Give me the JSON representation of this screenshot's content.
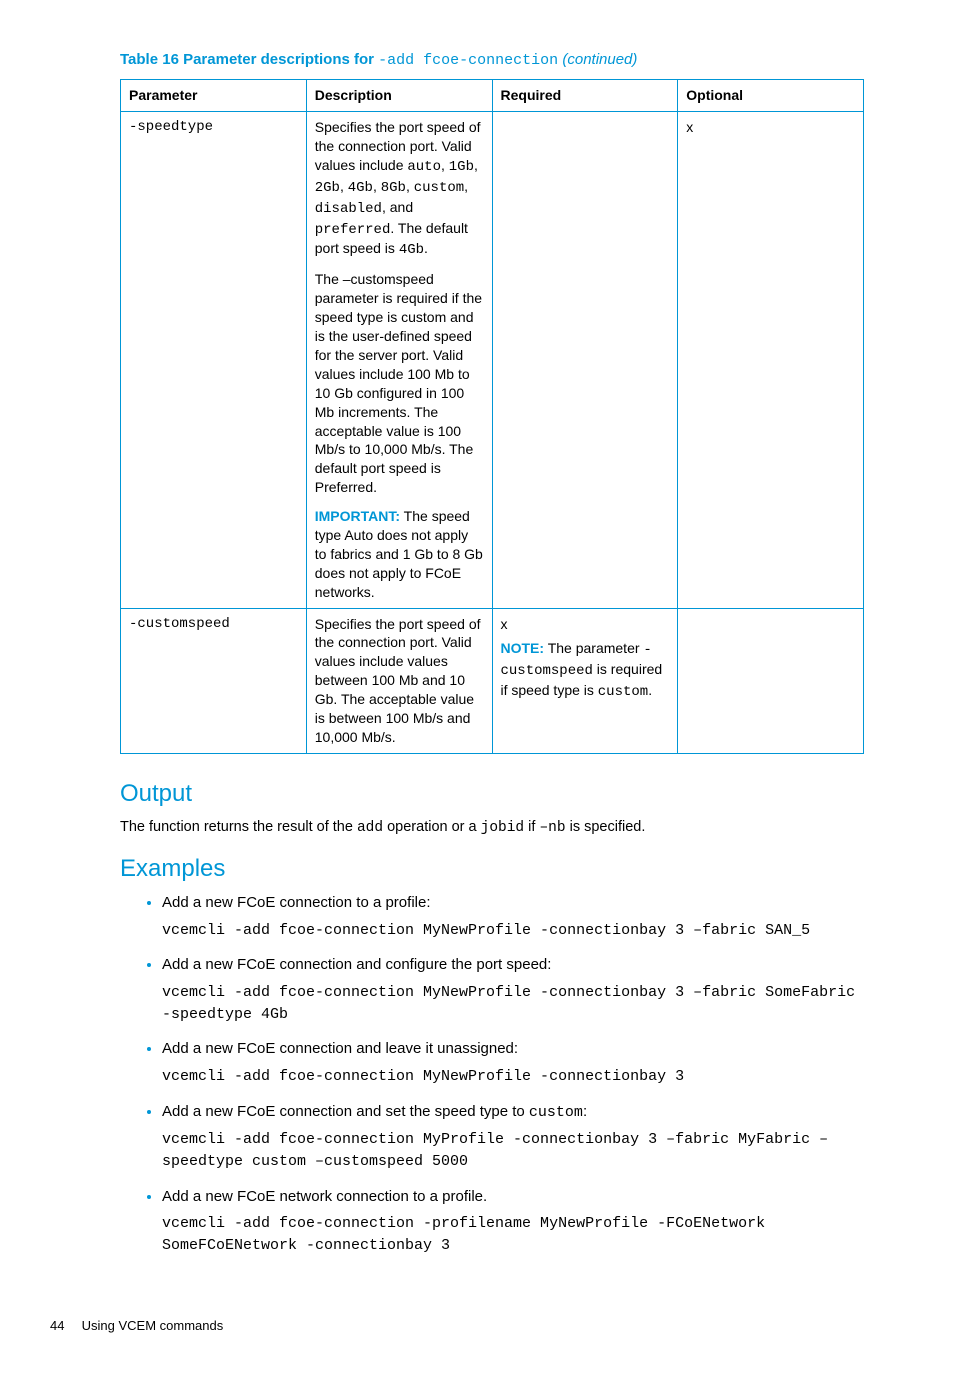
{
  "tableCaption": {
    "prefix": "Table 16 Parameter descriptions for ",
    "code": "-add fcoe-connection",
    "suffix": " (continued)"
  },
  "headers": {
    "param": "Parameter",
    "desc": "Description",
    "req": "Required",
    "opt": "Optional"
  },
  "row1": {
    "param": "-speedtype",
    "p1a": "Specifies the port speed of the connection port. Valid values include ",
    "p1code1": "auto",
    "p1mid": ", ",
    "p1code2": "1Gb",
    "p1mid2": ", ",
    "p1code3": "2Gb",
    "p1mid3": ", ",
    "p1code4": "4Gb",
    "p1mid4": ", ",
    "p1code5": "8Gb",
    "p1mid5": ", ",
    "p1code6": "custom",
    "p1mid6": ", ",
    "p1code7": "disabled",
    "p1mid7": ", and ",
    "p1code8": "preferred",
    "p1mid8": ". The default port speed is ",
    "p1code9": "4Gb",
    "p1end": ".",
    "p2": "The –customspeed parameter is required if the speed type is custom and is the user-defined speed for the server port. Valid values include 100 Mb to 10 Gb configured in 100 Mb increments. The acceptable value is 100 Mb/s to 10,000 Mb/s. The default port speed is Preferred.",
    "impLabel": "IMPORTANT:",
    "impText": " The speed type Auto does not apply to fabrics and 1 Gb to 8 Gb does not apply to FCoE networks.",
    "opt": "x"
  },
  "row2": {
    "param": "-customspeed",
    "desc": "Specifies the port speed of the connection port. Valid values include values between 100 Mb and 10 Gb. The acceptable value is between 100 Mb/s and 10,000 Mb/s.",
    "reqX": "x",
    "noteLabel": "NOTE:",
    "note1": " The parameter ",
    "noteCode": "-customspeed",
    "note2": " is required if speed type is ",
    "noteCode2": "custom",
    "note3": "."
  },
  "outputHeading": "Output",
  "outputText": {
    "a": "The function returns the result of the ",
    "code1": "add",
    "b": " operation or a ",
    "code2": "jobid",
    "c": " if ",
    "code3": "–nb",
    "d": " is specified."
  },
  "examplesHeading": "Examples",
  "examples": [
    {
      "label": "Add a new FCoE connection to a profile:",
      "code": "vcemcli -add fcoe-connection MyNewProfile -connectionbay 3 –fabric SAN_5"
    },
    {
      "label": "Add a new FCoE connection and configure the port speed:",
      "code": "vcemcli -add fcoe-connection MyNewProfile -connectionbay 3 –fabric SomeFabric -speedtype 4Gb"
    },
    {
      "label": "Add a new FCoE connection and leave it unassigned:",
      "code": "vcemcli -add fcoe-connection MyNewProfile -connectionbay 3"
    },
    {
      "labelPre": "Add a new FCoE connection and set the speed type to ",
      "labelCode": "custom",
      "labelPost": ":",
      "code": "vcemcli -add fcoe-connection MyProfile -connectionbay 3 –fabric MyFabric –speedtype custom –customspeed 5000"
    },
    {
      "label": "Add a new FCoE network connection to a profile.",
      "code": "vcemcli -add fcoe-connection -profilename MyNewProfile -FCoENetwork SomeFCoENetwork -connectionbay 3"
    }
  ],
  "footer": {
    "page": "44",
    "text": "Using VCEM commands"
  }
}
